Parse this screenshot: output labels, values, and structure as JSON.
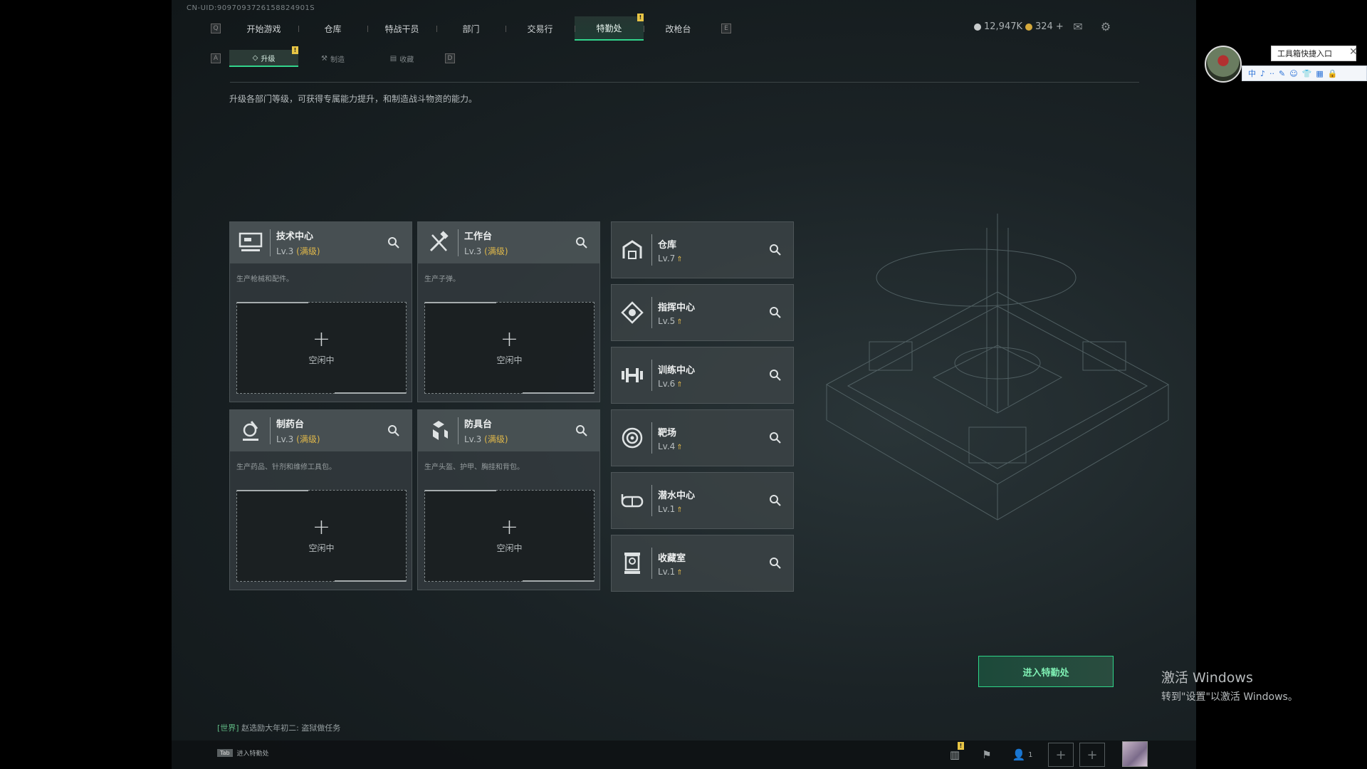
{
  "uid": "CN-UID:9097093726158824901S",
  "nav": {
    "left_key": "Q",
    "right_key": "E",
    "tabs": [
      "开始游戏",
      "仓库",
      "特战干员",
      "部门",
      "交易行",
      "特勤处",
      "改枪台"
    ],
    "active": "特勤处"
  },
  "currency": {
    "silver": "12,947K",
    "gold": "324",
    "gold_plus": "+"
  },
  "subnav": {
    "left_key": "A",
    "right_key": "D",
    "tabs": [
      "升级",
      "制造",
      "收藏"
    ],
    "active": "升级"
  },
  "description": "升级各部门等级，可获得专属能力提升，和制造战斗物资的能力。",
  "production_cards": [
    {
      "name": "技术中心",
      "level": "Lv.3",
      "max": "(满级)",
      "desc": "生产枪械和配件。",
      "slot_plus": "+",
      "slot_status": "空闲中",
      "icon": "computer-icon"
    },
    {
      "name": "工作台",
      "level": "Lv.3",
      "max": "(满级)",
      "desc": "生产子弹。",
      "slot_plus": "+",
      "slot_status": "空闲中",
      "icon": "tools-icon"
    },
    {
      "name": "制药台",
      "level": "Lv.3",
      "max": "(满级)",
      "desc": "生产药品、针剂和维修工具包。",
      "slot_plus": "+",
      "slot_status": "空闲中",
      "icon": "microscope-icon"
    },
    {
      "name": "防具台",
      "level": "Lv.3",
      "max": "(满级)",
      "desc": "生产头盔、护甲、胸挂和背包。",
      "slot_plus": "+",
      "slot_status": "空闲中",
      "icon": "armor-icon"
    }
  ],
  "departments": [
    {
      "name": "仓库",
      "level": "Lv.7",
      "icon": "warehouse-icon"
    },
    {
      "name": "指挥中心",
      "level": "Lv.5",
      "icon": "command-icon"
    },
    {
      "name": "训练中心",
      "level": "Lv.6",
      "icon": "dumbbell-icon"
    },
    {
      "name": "靶场",
      "level": "Lv.4",
      "icon": "target-icon"
    },
    {
      "name": "潜水中心",
      "level": "Lv.1",
      "icon": "diving-mask-icon"
    },
    {
      "name": "收藏室",
      "level": "Lv.1",
      "icon": "trophy-icon"
    }
  ],
  "enter_button": "进入特勤处",
  "chat": {
    "channel": "[世界]",
    "message": "赵选励大年初二: 盗狱做任务"
  },
  "tab_hint": {
    "key": "Tab",
    "label": "进入特勤处"
  },
  "friends_count": "1",
  "overlay": {
    "tooltip": "工具箱快捷入口",
    "ime": [
      "中",
      "♪",
      "··",
      "✎",
      "☺",
      "👕",
      "▦",
      "🔒"
    ]
  },
  "windows": {
    "line1": "激活 Windows",
    "line2": "转到\"设置\"以激活 Windows。"
  },
  "colors": {
    "accent": "#32d58c",
    "max_level": "#e0b84a",
    "badge": "#e8c545"
  }
}
